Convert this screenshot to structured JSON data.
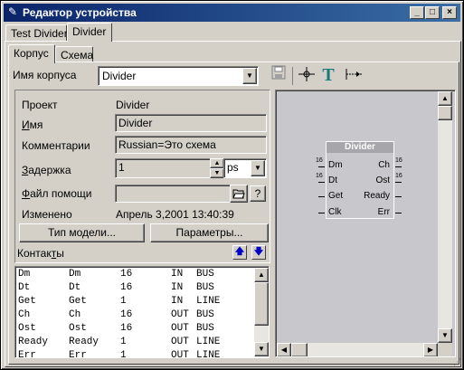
{
  "window": {
    "title": "Редактор устройства",
    "minimize_glyph": "_",
    "maximize_glyph": "□",
    "close_glyph": "×"
  },
  "top_tabs": [
    {
      "label": "Test Divider",
      "active": false
    },
    {
      "label": "Divider",
      "active": true
    }
  ],
  "sub_tabs": [
    {
      "label": "Корпус",
      "active": true
    },
    {
      "label": "Схема",
      "active": false
    }
  ],
  "package": {
    "label": "Имя корпуса",
    "value": "Divider"
  },
  "toolbar": {
    "icons": [
      "save-icon",
      "pin-tool-icon",
      "text-tool-icon",
      "connector-tool-icon"
    ]
  },
  "props": {
    "project_label": "Проект",
    "project_value": "Divider",
    "name_label": "Имя",
    "name_value": "Divider",
    "comments_label": "Комментарии",
    "comments_value": "Russian=Это схема",
    "delay_label": "Задержка",
    "delay_value": "1",
    "delay_unit": "ps",
    "help_label": "Файл помощи",
    "help_value": "",
    "help_question": "?",
    "modified_label": "Изменено",
    "modified_value": "Апрель 3,2001  13:40:39"
  },
  "buttons": {
    "model_type": "Тип модели...",
    "parameters": "Параметры..."
  },
  "contacts": {
    "label": "Контакты",
    "rows": [
      [
        "Dm",
        "Dm",
        "16",
        "IN",
        "BUS"
      ],
      [
        "Dt",
        "Dt",
        "16",
        "IN",
        "BUS"
      ],
      [
        "Get",
        "Get",
        "1",
        "IN",
        "LINE"
      ],
      [
        "Ch",
        "Ch",
        "16",
        "OUT",
        "BUS"
      ],
      [
        "Ost",
        "Ost",
        "16",
        "OUT",
        "BUS"
      ],
      [
        "Ready",
        "Ready",
        "1",
        "OUT",
        "LINE"
      ],
      [
        "Err",
        "Err",
        "1",
        "OUT",
        "LINE"
      ]
    ]
  },
  "symbol": {
    "title": "Divider",
    "left_pins": [
      {
        "name": "Dm",
        "bus": "16"
      },
      {
        "name": "Dt",
        "bus": "16"
      },
      {
        "name": "Get",
        "bus": ""
      },
      {
        "name": "Clk",
        "bus": ""
      }
    ],
    "right_pins": [
      {
        "name": "Ch",
        "bus": "16"
      },
      {
        "name": "Ost",
        "bus": "16"
      },
      {
        "name": "Ready",
        "bus": ""
      },
      {
        "name": "Err",
        "bus": ""
      }
    ]
  }
}
